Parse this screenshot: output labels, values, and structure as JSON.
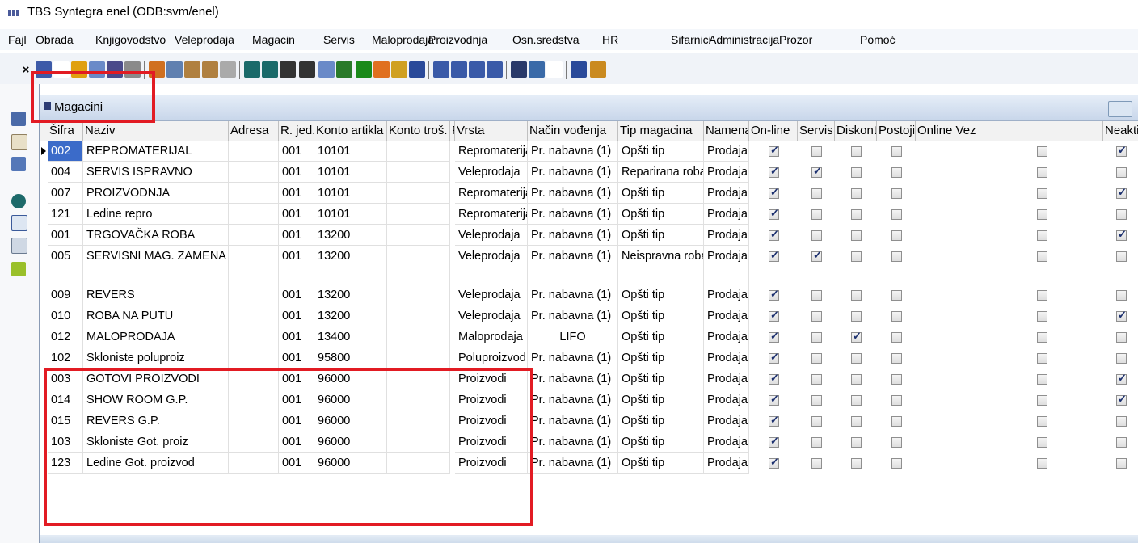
{
  "app": {
    "title": "TBS Syntegra enel   (ODB:svm/enel)"
  },
  "menu": [
    "Fajl",
    "Obrada",
    "Knjigovodstvo",
    "Veleprodaja",
    "Magacin",
    "Servis",
    "Maloprodaja",
    "Proizvodnja",
    "Osn.sredstva",
    "HR",
    "Sifarnici",
    "Administracija",
    "Prozor",
    "Pomoć"
  ],
  "toolbar": {
    "icons": [
      "close-icon",
      "save-icon",
      "new-document-icon",
      "undo-icon",
      "print-preview-icon",
      "print-icon",
      "lightning-icon",
      "cut-icon",
      "copy-icon",
      "paste-icon",
      "table-icon",
      "eraser-icon",
      "first-record-icon",
      "last-record-icon",
      "next-icon",
      "previous-icon",
      "refresh-icon",
      "tree-icon",
      "flag-icon",
      "pencil-icon",
      "tools-icon",
      "sort-icon",
      "columns-icon",
      "rows-icon",
      "list-icon",
      "window-icon",
      "calculator-icon",
      "edit-icon",
      "form-icon",
      "help-icon",
      "exit-icon"
    ],
    "close_glyph": "×"
  },
  "window": {
    "title": "Magacini"
  },
  "columns": [
    "Šifra",
    "Naziv",
    "Adresa",
    "R. jed.",
    "Konto artikla",
    "Konto troš.",
    "Prih.",
    "Vrsta",
    "Način vođenja",
    "Tip magacina",
    "Namena",
    "On-line",
    "Servis",
    "Diskont",
    "Postoji",
    "Online Vez",
    "Neaktivan"
  ],
  "rows": [
    {
      "sifra": "002",
      "naziv": "REPROMATERIJAL",
      "rjed": "001",
      "konto": "10101",
      "vrsta": "Repromaterijal",
      "nacin": "Pr. nabavna (1)",
      "tip": "Opšti tip",
      "namena": "Prodaja",
      "online": true,
      "servis": false,
      "diskont": false,
      "postoji": false,
      "neaktiv": true
    },
    {
      "sifra": "004",
      "naziv": "SERVIS ISPRAVNO",
      "rjed": "001",
      "konto": "10101",
      "vrsta": "Veleprodaja",
      "nacin": "Pr. nabavna (1)",
      "tip": "Reparirana roba",
      "namena": "Prodaja",
      "online": true,
      "servis": true,
      "diskont": false,
      "postoji": false,
      "neaktiv": false
    },
    {
      "sifra": "007",
      "naziv": "PROIZVODNJA",
      "rjed": "001",
      "konto": "10101",
      "vrsta": "Repromaterijal",
      "nacin": "Pr. nabavna (1)",
      "tip": "Opšti tip",
      "namena": "Prodaja",
      "online": true,
      "servis": false,
      "diskont": false,
      "postoji": false,
      "neaktiv": true
    },
    {
      "sifra": "121",
      "naziv": "Ledine repro",
      "rjed": "001",
      "konto": "10101",
      "vrsta": "Repromaterijal",
      "nacin": "Pr. nabavna (1)",
      "tip": "Opšti tip",
      "namena": "Prodaja",
      "online": true,
      "servis": false,
      "diskont": false,
      "postoji": false,
      "neaktiv": false
    },
    {
      "sifra": "001",
      "naziv": "TRGOVAČKA ROBA",
      "rjed": "001",
      "konto": "13200",
      "vrsta": "Veleprodaja",
      "nacin": "Pr. nabavna (1)",
      "tip": "Opšti tip",
      "namena": "Prodaja",
      "online": true,
      "servis": false,
      "diskont": false,
      "postoji": false,
      "neaktiv": true
    },
    {
      "sifra": "005",
      "naziv": "SERVISNI MAG. ZAMENA",
      "rjed": "001",
      "konto": "13200",
      "vrsta": "Veleprodaja",
      "nacin": "Pr. nabavna (1)",
      "tip": "Neispravna roba",
      "namena": "Prodaja",
      "online": true,
      "servis": true,
      "diskont": false,
      "postoji": false,
      "neaktiv": false,
      "tall": true
    },
    {
      "sifra": "009",
      "naziv": "REVERS",
      "rjed": "001",
      "konto": "13200",
      "vrsta": "Veleprodaja",
      "nacin": "Pr. nabavna (1)",
      "tip": "Opšti tip",
      "namena": "Prodaja",
      "online": true,
      "servis": false,
      "diskont": false,
      "postoji": false,
      "neaktiv": false
    },
    {
      "sifra": "010",
      "naziv": "ROBA NA PUTU",
      "rjed": "001",
      "konto": "13200",
      "vrsta": "Veleprodaja",
      "nacin": "Pr. nabavna (1)",
      "tip": "Opšti tip",
      "namena": "Prodaja",
      "online": true,
      "servis": false,
      "diskont": false,
      "postoji": false,
      "neaktiv": true
    },
    {
      "sifra": "012",
      "naziv": "MALOPRODAJA",
      "rjed": "001",
      "konto": "13400",
      "vrsta": "Maloprodaja",
      "nacin": "LIFO",
      "tip": "Opšti tip",
      "namena": "Prodaja",
      "online": true,
      "servis": false,
      "diskont": true,
      "postoji": false,
      "neaktiv": false
    },
    {
      "sifra": "102",
      "naziv": "Skloniste poluproiz",
      "rjed": "001",
      "konto": "95800",
      "vrsta": "Poluproizvod",
      "nacin": "Pr. nabavna (1)",
      "tip": "Opšti tip",
      "namena": "Prodaja",
      "online": true,
      "servis": false,
      "diskont": false,
      "postoji": false,
      "neaktiv": false
    },
    {
      "sifra": "003",
      "naziv": "GOTOVI PROIZVODI",
      "rjed": "001",
      "konto": "96000",
      "vrsta": "Proizvodi",
      "nacin": "Pr. nabavna (1)",
      "tip": "Opšti tip",
      "namena": "Prodaja",
      "online": true,
      "servis": false,
      "diskont": false,
      "postoji": false,
      "neaktiv": true
    },
    {
      "sifra": "014",
      "naziv": "SHOW ROOM G.P.",
      "rjed": "001",
      "konto": "96000",
      "vrsta": "Proizvodi",
      "nacin": "Pr. nabavna (1)",
      "tip": "Opšti tip",
      "namena": "Prodaja",
      "online": true,
      "servis": false,
      "diskont": false,
      "postoji": false,
      "neaktiv": true
    },
    {
      "sifra": "015",
      "naziv": "REVERS G.P.",
      "rjed": "001",
      "konto": "96000",
      "vrsta": "Proizvodi",
      "nacin": "Pr. nabavna (1)",
      "tip": "Opšti tip",
      "namena": "Prodaja",
      "online": true,
      "servis": false,
      "diskont": false,
      "postoji": false,
      "neaktiv": false
    },
    {
      "sifra": "103",
      "naziv": "Skloniste Got. proiz",
      "rjed": "001",
      "konto": "96000",
      "vrsta": "Proizvodi",
      "nacin": "Pr. nabavna (1)",
      "tip": "Opšti tip",
      "namena": "Prodaja",
      "online": true,
      "servis": false,
      "diskont": false,
      "postoji": false,
      "neaktiv": false
    },
    {
      "sifra": "123",
      "naziv": "Ledine Got. proizvod",
      "rjed": "001",
      "konto": "96000",
      "vrsta": "Proizvodi",
      "nacin": "Pr. nabavna (1)",
      "tip": "Opšti tip",
      "namena": "Prodaja",
      "online": true,
      "servis": false,
      "diskont": false,
      "postoji": false,
      "neaktiv": false
    }
  ],
  "colors": {
    "highlight": "#e21b23",
    "selection": "#3b6bc9"
  }
}
